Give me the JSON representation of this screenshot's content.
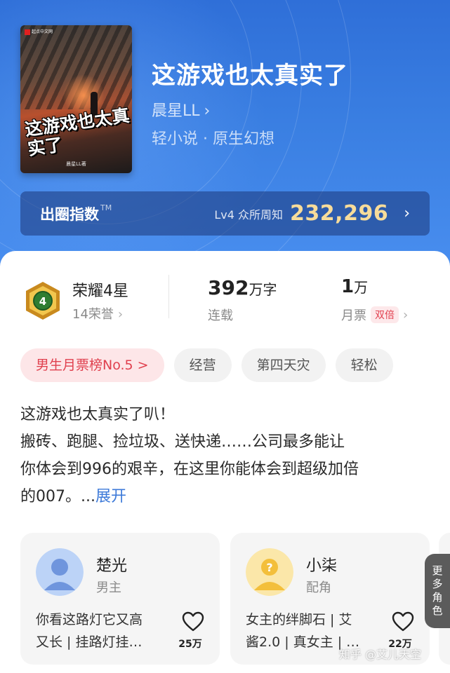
{
  "book": {
    "cover_title": "这游戏也太真实了",
    "cover_author": "晨星LL著",
    "cover_publisher": "起点中文网",
    "title": "这游戏也太真实了",
    "author": "晨星LL",
    "genre": "轻小说 · 原生幻想"
  },
  "index": {
    "title": "出圈指数",
    "tm": "TM",
    "level": "Lv4 众所周知",
    "value": "232,296"
  },
  "stats": {
    "honor_title": "荣耀4星",
    "honor_sub": "14荣誉",
    "medal_number": "4",
    "words_num": "392",
    "words_unit": "万字",
    "words_label": "连载",
    "tickets_num": "1",
    "tickets_unit": "万",
    "tickets_label": "月票",
    "double_badge": "双倍"
  },
  "tags": [
    "男生月票榜No.5 >",
    "经营",
    "第四天灾",
    "轻松"
  ],
  "description": {
    "lines": [
      "这游戏也太真实了叭！",
      "搬砖、跑腿、捡垃圾、送快递……公司最多能让",
      "你体会到996的艰辛，在这里你能体会到超级加倍",
      "的007。..."
    ],
    "expand": "展开"
  },
  "characters": [
    {
      "name": "楚光",
      "role": "男主",
      "desc1": "你看这路灯它又高",
      "desc2": "又长 | 挂路灯挂…",
      "likes": "25万"
    },
    {
      "name": "小柒",
      "role": "配角",
      "desc1": "女主的绊脚石 | 艾",
      "desc2": "酱2.0 | 真女主 | …",
      "likes": "22万"
    }
  ],
  "more_roles": "更多角色",
  "watermark": "知乎 @艾儿天空",
  "colors": {
    "hero_blue": "#3a7fe2",
    "index_gold": "#f7dc9a",
    "rank_red": "#e0404e",
    "link_blue": "#3d7ad9"
  }
}
